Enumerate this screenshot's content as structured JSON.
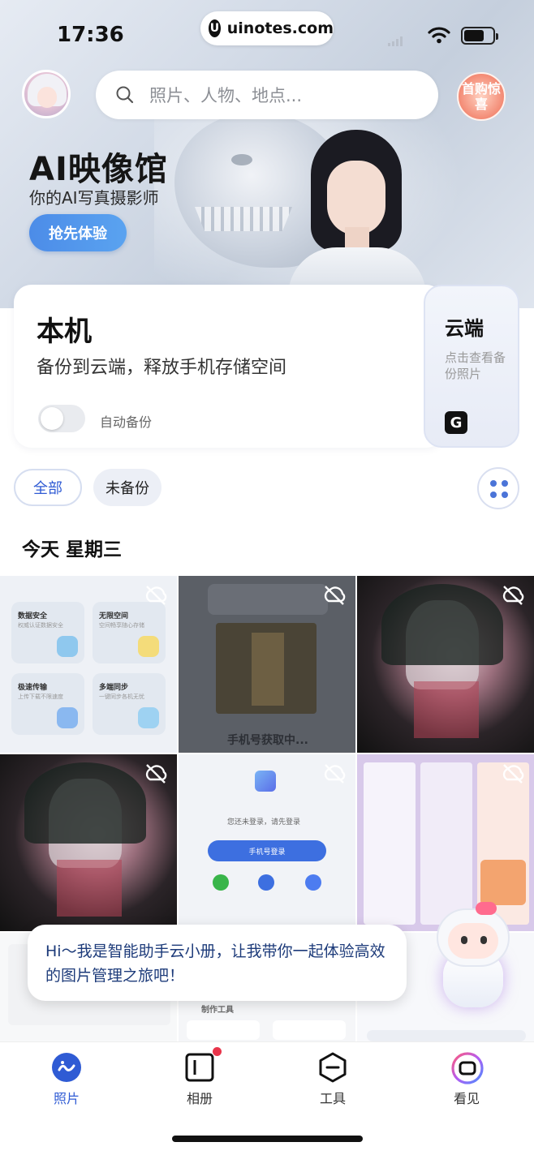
{
  "status_bar": {
    "time": "17:36",
    "url": "uinotes.com"
  },
  "header": {
    "search_placeholder": "照片、人物、地点...",
    "promo_badge": "首购惊喜"
  },
  "banner": {
    "title": "AI映像馆",
    "subtitle": "你的AI写真摄影师",
    "cta": "抢先体验"
  },
  "local_card": {
    "title": "本机",
    "description": "备份到云端，释放手机存储空间",
    "auto_backup_label": "自动备份",
    "auto_backup_on": false
  },
  "cloud_card": {
    "title": "云端",
    "description": "点击查看备份照片"
  },
  "filters": {
    "all": "全部",
    "not_backed_up": "未备份",
    "selected": "全部"
  },
  "section": {
    "date_heading": "今天  星期三"
  },
  "photos": {
    "feature_tiles": [
      {
        "title": "数据安全",
        "sub": "权威认证数据安全"
      },
      {
        "title": "无限空间",
        "sub": "空间畅享随心存储"
      },
      {
        "title": "极速传输",
        "sub": "上传下载不限速度"
      },
      {
        "title": "多端同步",
        "sub": "一键同步各机无忧"
      }
    ],
    "phone_caption": "手机号获取中...",
    "login_prompt": "您还未登录，请先登录",
    "login_button": "手机号登录",
    "tools_label": "制作工具"
  },
  "assistant": {
    "message": "Hi～我是智能助手云小册，让我带你一起体验高效的图片管理之旅吧！"
  },
  "tabs": [
    {
      "label": "照片",
      "icon": "photos-icon",
      "active": true
    },
    {
      "label": "相册",
      "icon": "album-icon",
      "active": false,
      "badge": true
    },
    {
      "label": "工具",
      "icon": "tools-icon",
      "active": false
    },
    {
      "label": "看见",
      "icon": "discover-icon",
      "active": false
    }
  ],
  "colors": {
    "accent": "#2f5bd4",
    "cta_blue": "#4c8ce8",
    "badge_red": "#e8344a"
  }
}
